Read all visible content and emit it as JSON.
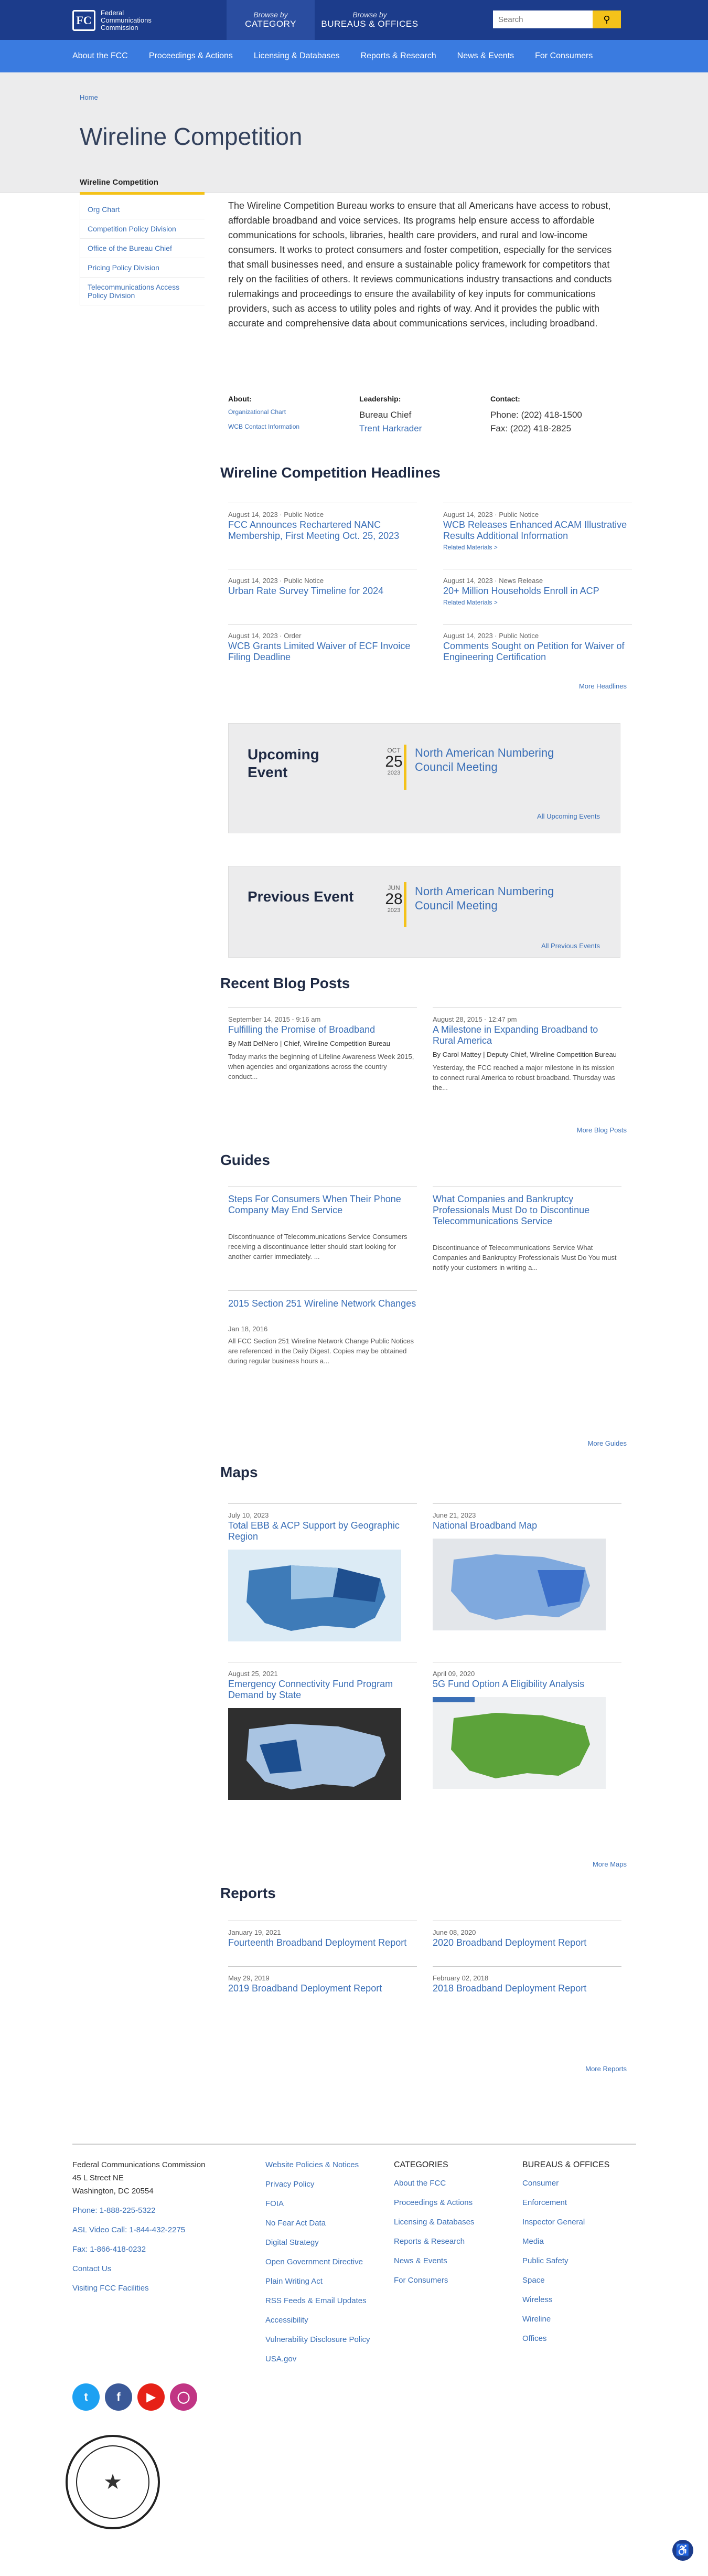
{
  "header": {
    "logo_lines": [
      "Federal",
      "Communications",
      "Commission"
    ],
    "browse_cat_sm": "Browse by",
    "browse_cat": "CATEGORY",
    "browse_bur_sm": "Browse by",
    "browse_bur": "BUREAUS & OFFICES",
    "search_placeholder": "Search"
  },
  "nav": [
    "About the FCC",
    "Proceedings & Actions",
    "Licensing & Databases",
    "Reports & Research",
    "News & Events",
    "For Consumers"
  ],
  "breadcrumb": "Home",
  "page_title": "Wireline Competition",
  "sidebar": {
    "title": "Wireline Competition",
    "items": [
      "Org Chart",
      "Competition Policy Division",
      "Office of the Bureau Chief",
      "Pricing Policy Division",
      "Telecommunications Access Policy Division"
    ]
  },
  "intro": "The Wireline Competition Bureau works to ensure that all Americans have access to robust, affordable broadband and voice services. Its programs help ensure access to affordable communications for schools, libraries, health care providers, and rural and low-income consumers. It works to protect consumers and foster competition, especially for the services that small businesses need, and ensure a sustainable policy framework for competitors that rely on the facilities of others. It reviews communications industry transactions and conducts rulemakings and proceedings to ensure the availability of key inputs for communications providers, such as access to utility poles and rights of way. And it provides the public with accurate and comprehensive data about communications services, including broadband.",
  "about": {
    "label": "About:",
    "links": [
      "Organizational Chart",
      "WCB Contact Information"
    ]
  },
  "leadership": {
    "label": "Leadership:",
    "role": "Bureau Chief",
    "name": "Trent Harkrader"
  },
  "contact": {
    "label": "Contact:",
    "phone": "Phone: (202) 418-1500",
    "fax": "Fax: (202) 418-2825"
  },
  "headlines": {
    "title": "Wireline Competition Headlines",
    "more": "More Headlines",
    "items": [
      {
        "meta": "August 14, 2023 · Public Notice",
        "title": "FCC Announces Rechartered NANC Membership, First Meeting Oct. 25, 2023",
        "rel": ""
      },
      {
        "meta": "August 14, 2023 · Public Notice",
        "title": "WCB Releases Enhanced ACAM Illustrative Results Additional Information",
        "rel": "Related Materials >"
      },
      {
        "meta": "August 14, 2023 · Public Notice",
        "title": "Urban Rate Survey Timeline for 2024",
        "rel": ""
      },
      {
        "meta": "August 14, 2023 · News Release",
        "title": "20+ Million Households Enroll in ACP",
        "rel": "Related Materials >"
      },
      {
        "meta": "August 14, 2023 · Order",
        "title": "WCB Grants Limited Waiver of ECF Invoice Filing Deadline",
        "rel": ""
      },
      {
        "meta": "August 14, 2023 · Public Notice",
        "title": "Comments Sought on Petition for Waiver of Engineering Certification",
        "rel": ""
      }
    ]
  },
  "upcoming": {
    "label_l1": "Upcoming",
    "label_l2": "Event",
    "month": "OCT",
    "day": "25",
    "year": "2023",
    "title": "North American Numbering Council Meeting",
    "link": "All Upcoming Events"
  },
  "previous": {
    "label": "Previous Event",
    "month": "JUN",
    "day": "28",
    "year": "2023",
    "title": "North American Numbering Council Meeting",
    "link": "All Previous Events"
  },
  "blog": {
    "title": "Recent Blog Posts",
    "more": "More Blog Posts",
    "items": [
      {
        "meta": "September 14, 2015 - 9:16 am",
        "title": "Fulfilling the Promise of Broadband",
        "by": "By Matt DelNero | Chief, Wireline Competition Bureau",
        "desc": "Today marks the beginning of Lifeline Awareness Week 2015, when agencies and organizations across the country conduct..."
      },
      {
        "meta": "August 28, 2015 - 12:47 pm",
        "title": "A Milestone in Expanding Broadband to Rural America",
        "by": "By Carol Mattey | Deputy Chief, Wireline Competition Bureau",
        "desc": "Yesterday, the FCC reached a major milestone in its mission to connect rural America to robust broadband. Thursday was the..."
      }
    ]
  },
  "guides": {
    "title": "Guides",
    "more": "More Guides",
    "items": [
      {
        "meta": "",
        "title": "Steps For Consumers When Their Phone Company May End Service",
        "desc": "Discontinuance of Telecommunications Service Consumers receiving a discontinuance letter should start looking for another carrier immediately. ..."
      },
      {
        "meta": "",
        "title": "What Companies and Bankruptcy Professionals Must Do to Discontinue Telecommunications Service",
        "desc": "Discontinuance of Telecommunications Service What Companies and Bankruptcy Professionals Must Do You must notify your customers in writing a..."
      },
      {
        "meta": "Jan 18, 2016",
        "title": "2015 Section 251 Wireline Network Changes",
        "desc": "All FCC Section 251 Wireline Network Change Public Notices are referenced in the Daily Digest. Copies may be obtained during regular business hours a..."
      }
    ]
  },
  "maps": {
    "title": "Maps",
    "more": "More Maps",
    "items": [
      {
        "meta": "July 10, 2023",
        "title": "Total EBB & ACP Support by Geographic Region"
      },
      {
        "meta": "June 21, 2023",
        "title": "National Broadband Map"
      },
      {
        "meta": "August 25, 2021",
        "title": "Emergency Connectivity Fund Program Demand by State"
      },
      {
        "meta": "April 09, 2020",
        "title": "5G Fund Option A Eligibility Analysis"
      }
    ]
  },
  "reports": {
    "title": "Reports",
    "more": "More Reports",
    "items": [
      {
        "meta": "January 19, 2021",
        "title": "Fourteenth Broadband Deployment Report"
      },
      {
        "meta": "June 08, 2020",
        "title": "2020 Broadband Deployment Report"
      },
      {
        "meta": "May 29, 2019",
        "title": "2019 Broadband Deployment Report"
      },
      {
        "meta": "February 02, 2018",
        "title": "2018 Broadband Deployment Report"
      }
    ]
  },
  "footer": {
    "address": [
      "Federal Communications Commission",
      "45 L Street NE",
      "Washington, DC 20554"
    ],
    "links": [
      "Phone: 1-888-225-5322",
      "ASL Video Call: 1-844-432-2275",
      "Fax: 1-866-418-0232",
      "Contact Us",
      "Visiting FCC Facilities"
    ],
    "col2": [
      "Website Policies & Notices",
      "Privacy Policy",
      "FOIA",
      "No Fear Act Data",
      "Digital Strategy",
      "Open Government Directive",
      "Plain Writing Act",
      "RSS Feeds & Email Updates",
      "Accessibility",
      "Vulnerability Disclosure Policy",
      "USA.gov"
    ],
    "categories_label": "CATEGORIES",
    "col3": [
      "About the FCC",
      "Proceedings & Actions",
      "Licensing & Databases",
      "Reports & Research",
      "News & Events",
      "For Consumers"
    ],
    "bureaus_label": "BUREAUS & OFFICES",
    "col4": [
      "Consumer",
      "Enforcement",
      "Inspector General",
      "Media",
      "Public Safety",
      "Space",
      "Wireless",
      "Wireline",
      "Offices"
    ]
  }
}
